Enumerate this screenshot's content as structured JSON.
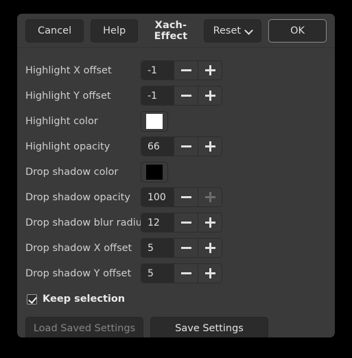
{
  "dialog": {
    "title": "Xach-Effect",
    "header": {
      "cancel_label": "Cancel",
      "help_label": "Help",
      "reset_label": "Reset",
      "reset_icon": "chevron-down-icon",
      "ok_label": "OK"
    },
    "rows": [
      {
        "label": "Highlight X offset",
        "type": "spin",
        "value": "-1",
        "minus_icon": "minus-icon",
        "plus_icon": "plus-icon",
        "minus_disabled": false,
        "plus_disabled": false
      },
      {
        "label": "Highlight Y offset",
        "type": "spin",
        "value": "-1",
        "minus_icon": "minus-icon",
        "plus_icon": "plus-icon",
        "minus_disabled": false,
        "plus_disabled": false
      },
      {
        "label": "Highlight color",
        "type": "color",
        "color": "#ffffff"
      },
      {
        "label": "Highlight opacity",
        "type": "spin",
        "value": "66",
        "minus_icon": "minus-icon",
        "plus_icon": "plus-icon",
        "minus_disabled": false,
        "plus_disabled": false
      },
      {
        "label": "Drop shadow color",
        "type": "color",
        "color": "#000000"
      },
      {
        "label": "Drop shadow opacity",
        "type": "spin",
        "value": "100",
        "minus_icon": "minus-icon",
        "plus_icon": "plus-icon",
        "minus_disabled": false,
        "plus_disabled": true
      },
      {
        "label": "Drop shadow blur radius",
        "type": "spin",
        "value": "12",
        "minus_icon": "minus-icon",
        "plus_icon": "plus-icon",
        "minus_disabled": false,
        "plus_disabled": false
      },
      {
        "label": "Drop shadow X offset",
        "type": "spin",
        "value": "5",
        "minus_icon": "minus-icon",
        "plus_icon": "plus-icon",
        "minus_disabled": false,
        "plus_disabled": false
      },
      {
        "label": "Drop shadow Y offset",
        "type": "spin",
        "value": "5",
        "minus_icon": "minus-icon",
        "plus_icon": "plus-icon",
        "minus_disabled": false,
        "plus_disabled": false
      }
    ],
    "keep_selection": {
      "label": "Keep selection",
      "checked": true
    },
    "footer": {
      "load_label": "Load Saved Settings",
      "load_disabled": true,
      "save_label": "Save Settings",
      "save_disabled": false
    }
  },
  "colors": {
    "window_bg": "#3a3a3a",
    "desktop_bg": "#000000",
    "button_bg": "#2b2b2b",
    "entry_bg": "#2a2a2a",
    "text": "#dedede",
    "text_disabled": "#858585",
    "default_border": "#8b8b8b"
  }
}
